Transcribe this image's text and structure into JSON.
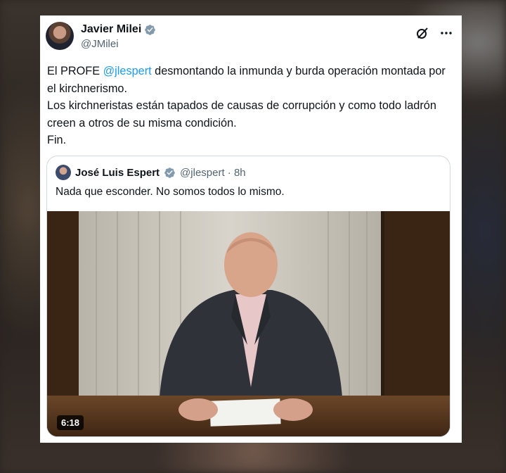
{
  "author": {
    "name": "Javier Milei",
    "handle": "@JMilei"
  },
  "tweet": {
    "line1_before": "El PROFE ",
    "line1_mention": "@jlespert",
    "line1_after": " desmontando la inmunda y burda operación montada por el kirchnerismo.",
    "line2": "Los kirchneristas están tapados de causas de corrupción y como todo ladrón creen a otros de su misma condición.",
    "line3": "Fin."
  },
  "quoted": {
    "name": "José Luis Espert",
    "handle_time": "@jlespert · 8h",
    "text": "Nada que esconder. No somos todos lo mismo.",
    "video_duration": "6:18"
  },
  "icons": {
    "verified": "verified-badge-icon",
    "grok": "grok-icon",
    "more": "more-options-icon"
  },
  "colors": {
    "link": "#1d9bf0",
    "verified": "#829aab",
    "text": "#0f1419",
    "secondary": "#536471"
  }
}
